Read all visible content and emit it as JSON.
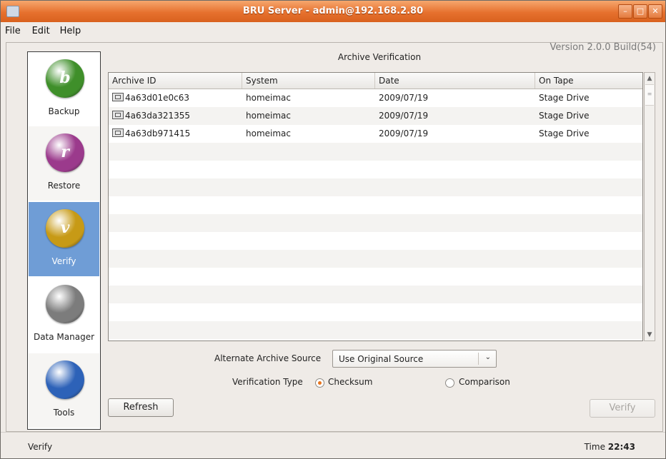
{
  "window": {
    "title": "BRU Server - admin@192.168.2.80",
    "controls": [
      "–",
      "□",
      "✕"
    ]
  },
  "menu": [
    "File",
    "Edit",
    "Help"
  ],
  "version": "Version 2.0.0 Build(54)",
  "sidebar": [
    {
      "label": "Backup",
      "glyph": "b",
      "color": "#3f8f2a"
    },
    {
      "label": "Restore",
      "glyph": "r",
      "color": "#9b3a8c"
    },
    {
      "label": "Verify",
      "glyph": "v",
      "color": "#c79a16",
      "active": true
    },
    {
      "label": "Data Manager",
      "glyph": "",
      "color": "#7c7c7c"
    },
    {
      "label": "Tools",
      "glyph": "",
      "color": "#2d62b8"
    }
  ],
  "main": {
    "heading": "Archive Verification",
    "columns": [
      "Archive ID",
      "System",
      "Date",
      "On Tape"
    ],
    "rows": [
      {
        "id": "4a63d01e0c63",
        "system": "homeimac",
        "date": "2009/07/19",
        "tape": "Stage Drive"
      },
      {
        "id": "4a63da321355",
        "system": "homeimac",
        "date": "2009/07/19",
        "tape": "Stage Drive"
      },
      {
        "id": "4a63db971415",
        "system": "homeimac",
        "date": "2009/07/19",
        "tape": "Stage Drive"
      }
    ],
    "alt_source_label": "Alternate Archive Source",
    "alt_source_value": "Use Original Source",
    "verification_type_label": "Verification Type",
    "option_checksum": "Checksum",
    "option_comparison": "Comparison",
    "refresh_label": "Refresh",
    "verify_label": "Verify"
  },
  "status": {
    "left": "Verify",
    "time_label": "Time",
    "time_value": "22:43"
  }
}
